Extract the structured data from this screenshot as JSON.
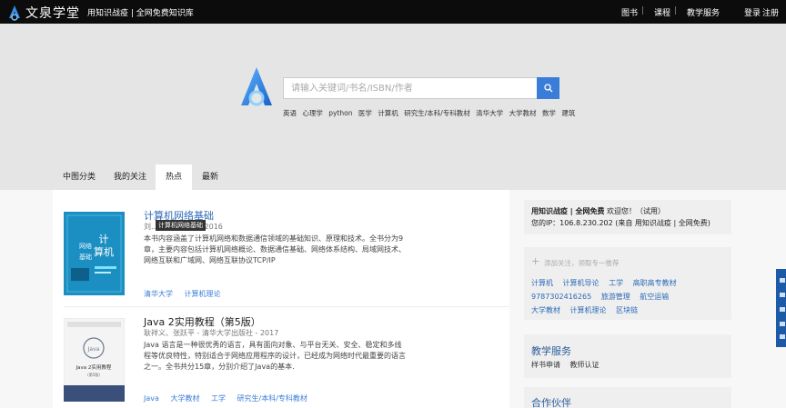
{
  "header": {
    "logo_text": "文泉学堂",
    "tagline": "用知识战疫 | 全网免费知识库",
    "nav": [
      "图书",
      "课程",
      "教学服务"
    ],
    "auth": [
      "登录",
      "注册"
    ]
  },
  "search": {
    "placeholder": "请输入关键词/书名/ISBN/作者",
    "hot_keywords": [
      "英语",
      "心理学",
      "python",
      "医学",
      "计算机",
      "研究生/本科/专科教材",
      "清华大学",
      "大学教材",
      "数学",
      "建筑"
    ]
  },
  "tabs": [
    {
      "label": "中图分类",
      "active": false
    },
    {
      "label": "我的关注",
      "active": false
    },
    {
      "label": "热点",
      "active": true
    },
    {
      "label": "最新",
      "active": false
    }
  ],
  "books": [
    {
      "title": "计算机网络基础",
      "meta": "刘… 大学出版社 - 2016",
      "tooltip": "计算机网络基础",
      "description": "本书内容涵盖了计算机网络和数据通信领域的基础知识、原理和技术。全书分为9章，主要内容包括计算机网络概论、数据通信基础、网络体系结构、局域网技术、网络互联和广域网、网络互联协议TCP/IP",
      "tags": [
        "清华大学",
        "计算机理论"
      ],
      "cover_text": "计算机网络基础"
    },
    {
      "title": "Java 2实用教程（第5版）",
      "meta": "耿祥义、张跃平 - 清华大学出版社 - 2017",
      "description": "Java 语言是一种很优秀的语言，具有面向对象、与平台无关、安全、稳定和多线程等优良特性，特别适合于网络应用程序的设计，已经成为网络时代最重要的语言之一。全书共分15章，分别介绍了Java的基本.",
      "tags": [
        "Java",
        "大学教材",
        "工学",
        "研究生/本科/专科教材"
      ],
      "cover_text": "Java 2实用教程"
    }
  ],
  "sidebar": {
    "welcome": {
      "line1_bold": "用知识战疫 | 全网免费",
      "line1_rest": " 欢迎您！（试用）",
      "line2": "您的IP：106.8.230.202 (来自 用知识战疫 | 全网免费)"
    },
    "follow": {
      "hint": "添加关注，领取专一推荐",
      "links_row1": [
        "计算机",
        "计算机导论",
        "工学",
        "高职高专教材"
      ],
      "links_row2": [
        "9787302416265",
        "旅游管理",
        "航空运输"
      ],
      "links_row3": [
        "大学教材",
        "计算机理论",
        "区块链"
      ]
    },
    "teaching": {
      "heading": "教学服务",
      "items": [
        "样书申请",
        "教师认证"
      ]
    },
    "partners": {
      "heading": "合作伙伴"
    }
  },
  "colors": {
    "accent": "#3a7dd8",
    "topbar": "#0c0c0c",
    "hero_bg": "#e5e5e5",
    "float_tab": "#1c5aa8"
  }
}
